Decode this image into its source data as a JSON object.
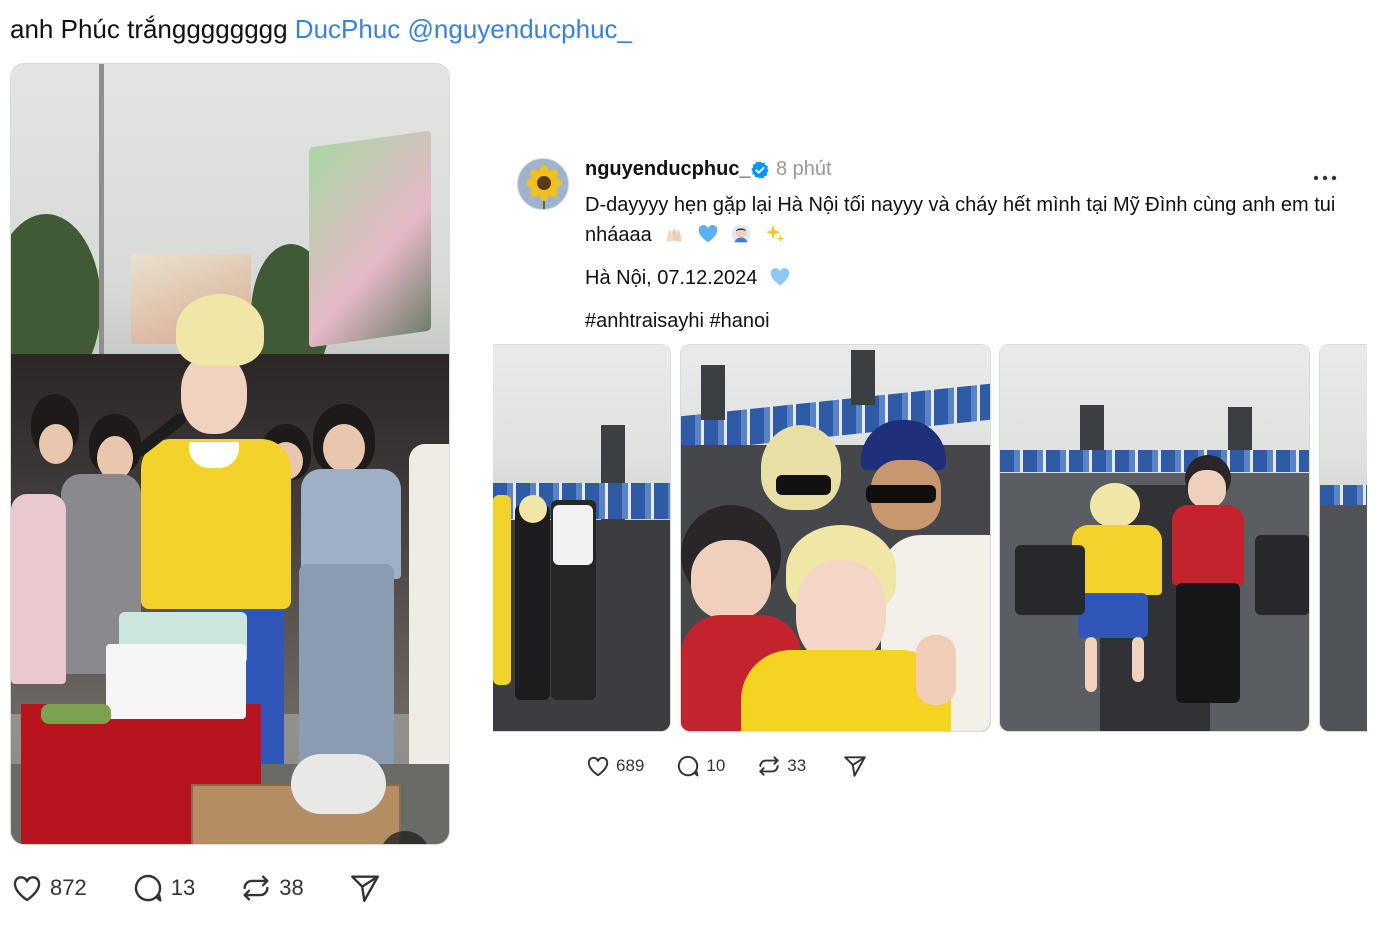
{
  "first_post": {
    "text_plain": "anh Phúc trắngggggggg ",
    "mention_name": "DucPhuc",
    "mention_handle": "@nguyenducphuc_",
    "mute_icon": "speaker-muted-icon",
    "likes": "872",
    "replies": "13",
    "reposts": "38"
  },
  "embedded_post": {
    "username": "nguyenducphuc_",
    "verified": true,
    "time": "8 phút",
    "caption_line1": "D-dayyyy hẹn gặp lại Hà Nội tối nayyy và cháy hết mình tại Mỹ Đình cùng anh em tui nháaaa",
    "caption_emojis": [
      "raised-hands-emoji",
      "blue-heart-emoji",
      "man-emoji",
      "sparkles-emoji"
    ],
    "location_date": "Hà Nội, 07.12.2024",
    "location_emoji": "light-blue-heart-emoji",
    "hashtags": "#anhtraisayhi #hanoi",
    "likes": "689",
    "replies": "10",
    "reposts": "33"
  },
  "colors": {
    "link": "#3a82d6",
    "verified": "#0095f6",
    "meta_gray": "#999999",
    "text": "#101010"
  }
}
